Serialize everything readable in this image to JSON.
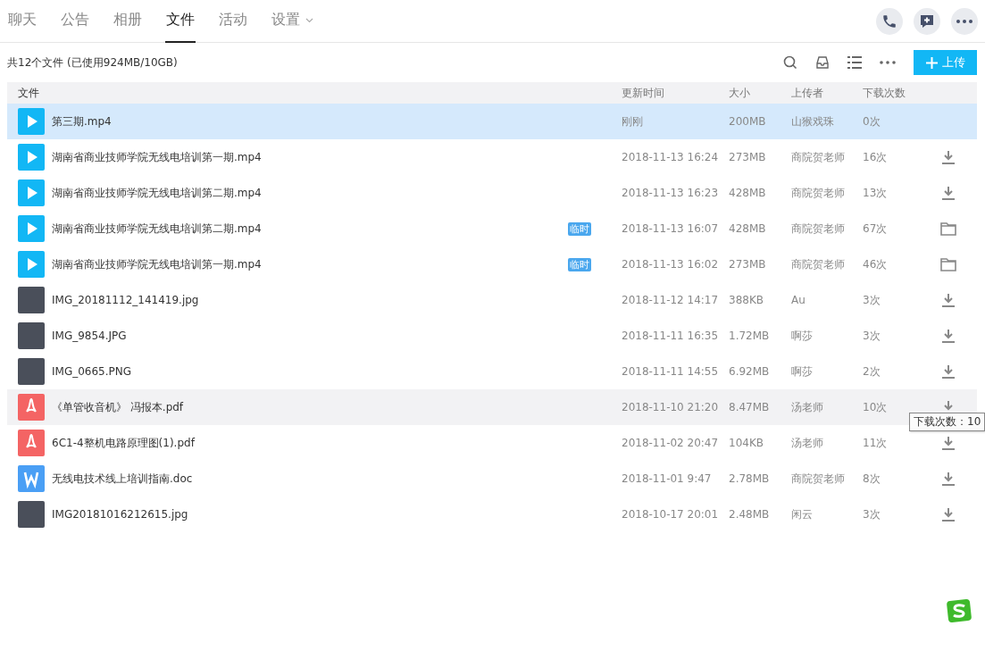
{
  "tabs": [
    {
      "label": "聊天",
      "selected": false
    },
    {
      "label": "公告",
      "selected": false
    },
    {
      "label": "相册",
      "selected": false
    },
    {
      "label": "文件",
      "selected": true
    },
    {
      "label": "活动",
      "selected": false
    },
    {
      "label": "设置",
      "selected": false,
      "dropdown": true
    }
  ],
  "summary": "共12个文件 (已使用924MB/10GB)",
  "upload_button": "上传",
  "columns": [
    "文件",
    "更新时间",
    "大小",
    "上传者",
    "下载次数"
  ],
  "rows": [
    {
      "kind": "video",
      "name": "第三期.mp4",
      "time": "刚刚",
      "size": "200MB",
      "uploader": "山猴戏珠",
      "downloads": "0次",
      "selected": true,
      "hovered": false
    },
    {
      "kind": "video",
      "name": "湖南省商业技师学院无线电培训第一期.mp4",
      "time": "2018-11-13 16:24",
      "size": "273MB",
      "uploader": "商院贺老师",
      "downloads": "16次",
      "action": {
        "kind": "download"
      },
      "selected": false,
      "hovered": false
    },
    {
      "kind": "video",
      "name": "湖南省商业技师学院无线电培训第二期.mp4",
      "time": "2018-11-13 16:23",
      "size": "428MB",
      "uploader": "商院贺老师",
      "downloads": "13次",
      "action": {
        "kind": "download"
      },
      "selected": false,
      "hovered": false
    },
    {
      "kind": "video",
      "name": "湖南省商业技师学院无线电培训第二期.mp4",
      "tag": "临时",
      "time": "2018-11-13 16:07",
      "size": "428MB",
      "uploader": "商院贺老师",
      "downloads": "67次",
      "action": {
        "kind": "folder"
      },
      "selected": false,
      "hovered": false
    },
    {
      "kind": "video",
      "name": "湖南省商业技师学院无线电培训第一期.mp4",
      "tag": "临时",
      "time": "2018-11-13 16:02",
      "size": "273MB",
      "uploader": "商院贺老师",
      "downloads": "46次",
      "action": {
        "kind": "folder"
      },
      "selected": false,
      "hovered": false
    },
    {
      "kind": "image",
      "name": "IMG_20181112_141419.jpg",
      "time": "2018-11-12 14:17",
      "size": "388KB",
      "uploader": "Au",
      "downloads": "3次",
      "action": {
        "kind": "download"
      },
      "selected": false,
      "hovered": false
    },
    {
      "kind": "image",
      "name": "IMG_9854.JPG",
      "time": "2018-11-11 16:35",
      "size": "1.72MB",
      "uploader": "啊莎",
      "downloads": "3次",
      "action": {
        "kind": "download"
      },
      "selected": false,
      "hovered": false
    },
    {
      "kind": "image",
      "name": "IMG_0665.PNG",
      "time": "2018-11-11 14:55",
      "size": "6.92MB",
      "uploader": "啊莎",
      "downloads": "2次",
      "action": {
        "kind": "download"
      },
      "selected": false,
      "hovered": false
    },
    {
      "kind": "pdf",
      "name": "《单管收音机》 冯报本.pdf",
      "time": "2018-11-10 21:20",
      "size": "8.47MB",
      "uploader": "汤老师",
      "downloads": "10次",
      "action": {
        "kind": "download"
      },
      "selected": false,
      "hovered": true,
      "tooltip": "下载次数：10"
    },
    {
      "kind": "pdf",
      "name": "6C1-4整机电路原理图(1).pdf",
      "time": "2018-11-02 20:47",
      "size": "104KB",
      "uploader": "汤老师",
      "downloads": "11次",
      "action": {
        "kind": "download"
      },
      "selected": false,
      "hovered": false
    },
    {
      "kind": "doc",
      "name": "无线电技术线上培训指南.doc",
      "time": "2018-11-01 9:47",
      "size": "2.78MB",
      "uploader": "商院贺老师",
      "downloads": "8次",
      "action": {
        "kind": "download"
      },
      "selected": false,
      "hovered": false
    },
    {
      "kind": "image",
      "name": "IMG20181016212615.jpg",
      "time": "2018-10-17 20:01",
      "size": "2.48MB",
      "uploader": "闲云",
      "downloads": "3次",
      "action": {
        "kind": "download"
      },
      "selected": false,
      "hovered": false
    }
  ]
}
